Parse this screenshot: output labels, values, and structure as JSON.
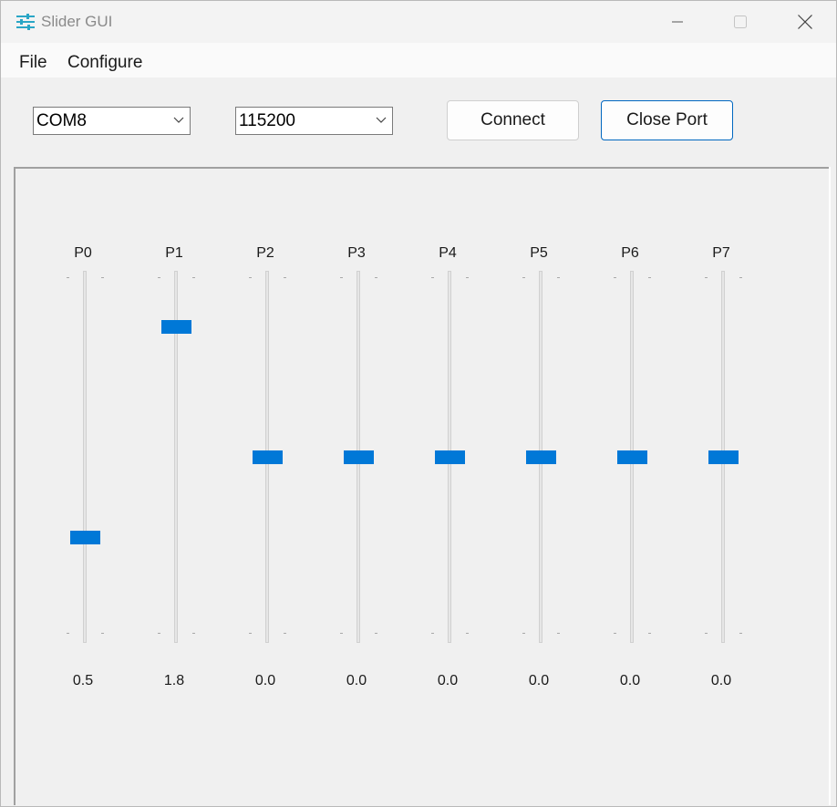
{
  "window": {
    "title": "Slider GUI",
    "icon": "sliders-icon"
  },
  "menu": {
    "file": "File",
    "configure": "Configure"
  },
  "toolbar": {
    "port_value": "COM8",
    "baud_value": "115200",
    "connect_label": "Connect",
    "close_port_label": "Close Port"
  },
  "colors": {
    "accent": "#0078d7",
    "focus_border": "#0067c0"
  },
  "sliders": [
    {
      "label": "P0",
      "value": "0.5",
      "position": 0.26
    },
    {
      "label": "P1",
      "value": "1.8",
      "position": 0.885
    },
    {
      "label": "P2",
      "value": "0.0",
      "position": 0.5
    },
    {
      "label": "P3",
      "value": "0.0",
      "position": 0.5
    },
    {
      "label": "P4",
      "value": "0.0",
      "position": 0.5
    },
    {
      "label": "P5",
      "value": "0.0",
      "position": 0.5
    },
    {
      "label": "P6",
      "value": "0.0",
      "position": 0.5
    },
    {
      "label": "P7",
      "value": "0.0",
      "position": 0.5
    }
  ]
}
